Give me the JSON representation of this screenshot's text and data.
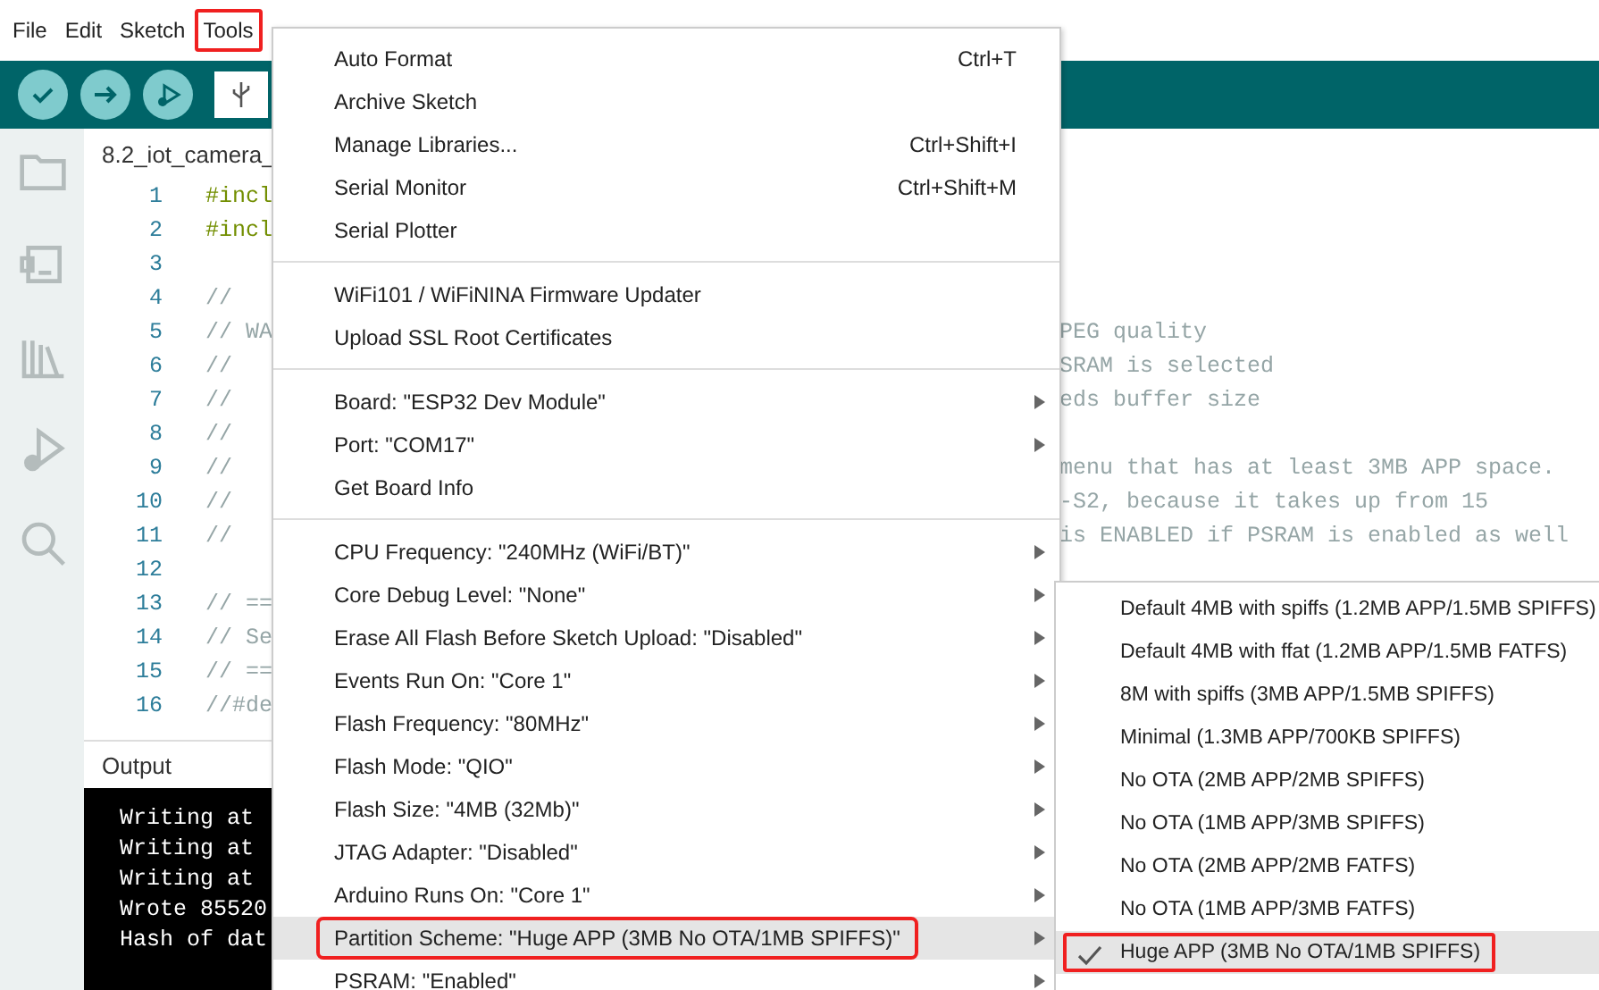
{
  "menubar": [
    {
      "label": "File",
      "annotated": false
    },
    {
      "label": "Edit",
      "annotated": false
    },
    {
      "label": "Sketch",
      "annotated": false
    },
    {
      "label": "Tools",
      "annotated": true
    }
  ],
  "editor": {
    "tab": "8.2_iot_camera_",
    "lines": [
      {
        "number": "1",
        "kind": "directive",
        "left": "#incl"
      },
      {
        "number": "2",
        "kind": "directive",
        "left": "#incl"
      },
      {
        "number": "3"
      },
      {
        "number": "4",
        "kind": "comment",
        "left": "//"
      },
      {
        "number": "5",
        "kind": "comment",
        "left": "// WA",
        "right": "PEG quality"
      },
      {
        "number": "6",
        "kind": "comment",
        "left": "//",
        "right": "SRAM is selected"
      },
      {
        "number": "7",
        "kind": "comment",
        "left": "//",
        "right": "eds buffer size"
      },
      {
        "number": "8",
        "kind": "comment",
        "left": "//"
      },
      {
        "number": "9",
        "kind": "comment",
        "left": "//",
        "right": "menu that has at least 3MB APP space."
      },
      {
        "number": "10",
        "kind": "comment",
        "left": "//",
        "right": "-S2, because it takes up from 15"
      },
      {
        "number": "11",
        "kind": "comment",
        "left": "//",
        "right": "is ENABLED if PSRAM is enabled as well"
      },
      {
        "number": "12"
      },
      {
        "number": "13",
        "kind": "comment",
        "left": "// =="
      },
      {
        "number": "14",
        "kind": "comment",
        "left": "// Se"
      },
      {
        "number": "15",
        "kind": "comment",
        "left": "// =="
      },
      {
        "number": "16",
        "kind": "comment",
        "left": "//#de"
      }
    ]
  },
  "output": {
    "title": "Output",
    "lines": [
      "Writing at",
      "Writing at",
      "Writing at",
      "Wrote 85520",
      "Hash of dat"
    ]
  },
  "tools_menu": [
    {
      "kind": "item",
      "label": "Auto Format",
      "shortcut": "Ctrl+T"
    },
    {
      "kind": "item",
      "label": "Archive Sketch"
    },
    {
      "kind": "item",
      "label": "Manage Libraries...",
      "shortcut": "Ctrl+Shift+I"
    },
    {
      "kind": "item",
      "label": "Serial Monitor",
      "shortcut": "Ctrl+Shift+M"
    },
    {
      "kind": "item",
      "label": "Serial Plotter"
    },
    {
      "kind": "separator"
    },
    {
      "kind": "item",
      "label": "WiFi101 / WiFiNINA Firmware Updater"
    },
    {
      "kind": "item",
      "label": "Upload SSL Root Certificates"
    },
    {
      "kind": "separator"
    },
    {
      "kind": "submenu",
      "label": "Board: \"ESP32 Dev Module\"",
      "open": false,
      "annotated": false
    },
    {
      "kind": "submenu",
      "label": "Port: \"COM17\"",
      "open": false,
      "annotated": false
    },
    {
      "kind": "item",
      "label": "Get Board Info"
    },
    {
      "kind": "separator"
    },
    {
      "kind": "submenu",
      "label": "CPU Frequency: \"240MHz (WiFi/BT)\"",
      "open": false,
      "annotated": false
    },
    {
      "kind": "submenu",
      "label": "Core Debug Level: \"None\"",
      "open": false,
      "annotated": false
    },
    {
      "kind": "submenu",
      "label": "Erase All Flash Before Sketch Upload: \"Disabled\"",
      "open": false,
      "annotated": false
    },
    {
      "kind": "submenu",
      "label": "Events Run On: \"Core 1\"",
      "open": false,
      "annotated": false
    },
    {
      "kind": "submenu",
      "label": "Flash Frequency: \"80MHz\"",
      "open": false,
      "annotated": false
    },
    {
      "kind": "submenu",
      "label": "Flash Mode: \"QIO\"",
      "open": false,
      "annotated": false
    },
    {
      "kind": "submenu",
      "label": "Flash Size: \"4MB (32Mb)\"",
      "open": false,
      "annotated": false
    },
    {
      "kind": "submenu",
      "label": "JTAG Adapter: \"Disabled\"",
      "open": false,
      "annotated": false
    },
    {
      "kind": "submenu",
      "label": "Arduino Runs On: \"Core 1\"",
      "open": false,
      "annotated": false
    },
    {
      "kind": "submenu",
      "label": "Partition Scheme: \"Huge APP (3MB No OTA/1MB SPIFFS)\"",
      "open": true,
      "annotated": true
    },
    {
      "kind": "submenu",
      "label": "PSRAM: \"Enabled\"",
      "open": false,
      "annotated": false
    }
  ],
  "partition_submenu": [
    {
      "label": "Default 4MB with spiffs (1.2MB APP/1.5MB SPIFFS)",
      "selected": false,
      "annotated": false
    },
    {
      "label": "Default 4MB with ffat (1.2MB APP/1.5MB FATFS)",
      "selected": false,
      "annotated": false
    },
    {
      "label": "8M with spiffs (3MB APP/1.5MB SPIFFS)",
      "selected": false,
      "annotated": false
    },
    {
      "label": "Minimal (1.3MB APP/700KB SPIFFS)",
      "selected": false,
      "annotated": false
    },
    {
      "label": "No OTA (2MB APP/2MB SPIFFS)",
      "selected": false,
      "annotated": false
    },
    {
      "label": "No OTA (1MB APP/3MB SPIFFS)",
      "selected": false,
      "annotated": false
    },
    {
      "label": "No OTA (2MB APP/2MB FATFS)",
      "selected": false,
      "annotated": false
    },
    {
      "label": "No OTA (1MB APP/3MB FATFS)",
      "selected": false,
      "annotated": false
    },
    {
      "label": "Huge APP (3MB No OTA/1MB SPIFFS)",
      "selected": true,
      "annotated": true
    }
  ]
}
